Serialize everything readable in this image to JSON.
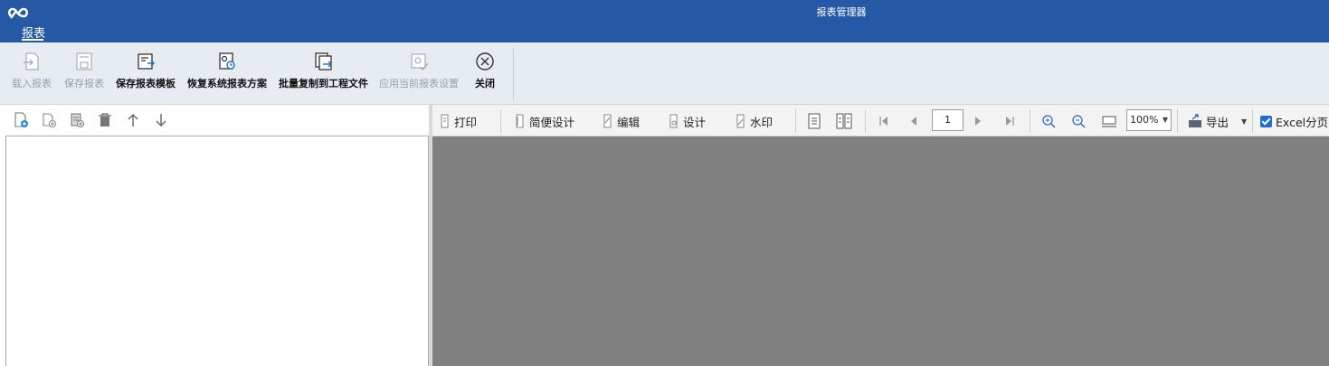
{
  "window": {
    "title": "报表管理器"
  },
  "ribbon": {
    "tab_label": "报表",
    "buttons": [
      {
        "label": "载入报表",
        "enabled": false,
        "icon": "load-report-icon"
      },
      {
        "label": "保存报表",
        "enabled": false,
        "icon": "save-report-icon"
      },
      {
        "label": "保存报表模板",
        "enabled": true,
        "icon": "save-template-icon"
      },
      {
        "label": "恢复系统报表方案",
        "enabled": true,
        "icon": "restore-scheme-icon"
      },
      {
        "label": "批量复制到工程文件",
        "enabled": true,
        "icon": "batch-copy-icon"
      },
      {
        "label": "应用当前报表设置",
        "enabled": false,
        "icon": "apply-settings-icon"
      },
      {
        "label": "关闭",
        "enabled": true,
        "icon": "close-circle-icon"
      }
    ]
  },
  "left_toolbar": {
    "icons": [
      "new-report-icon",
      "add-report-icon",
      "add-item-icon",
      "delete-icon",
      "move-up-icon",
      "move-down-icon"
    ]
  },
  "preview_toolbar": {
    "print": "打印",
    "simple_design": "简便设计",
    "edit": "编辑",
    "design": "设计",
    "watermark": "水印",
    "page": "1",
    "zoom": "100%",
    "export": "导出",
    "excel_paging": "Excel分页",
    "excel_paging_checked": true
  },
  "colors": {
    "titlebar": "#2558a5",
    "ribbon": "#e7ebf2",
    "preview_bg": "#808080",
    "checkbox": "#1f6fd1"
  }
}
